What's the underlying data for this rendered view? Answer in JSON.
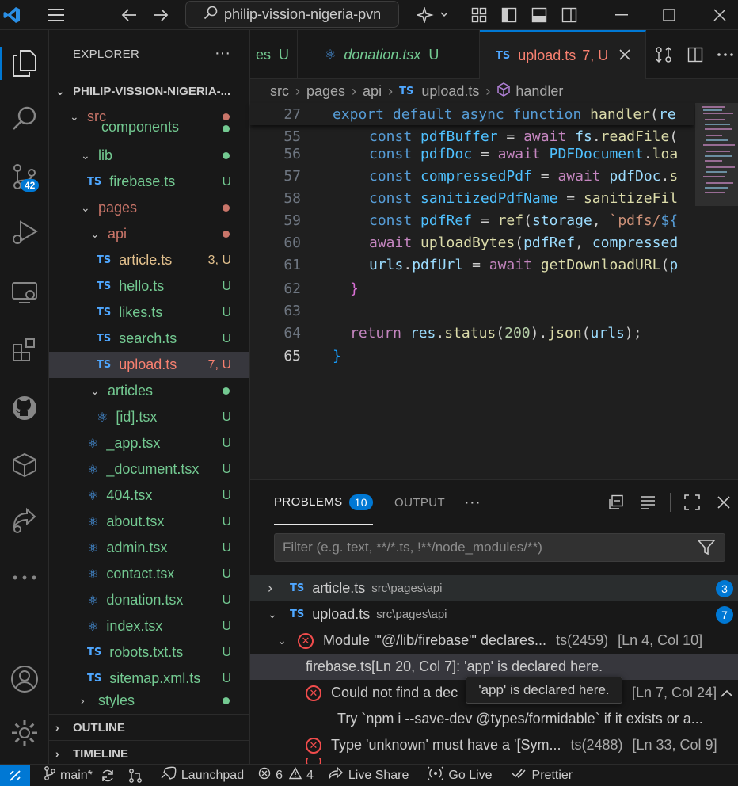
{
  "colors": {
    "accent": "#0078d4",
    "untracked": "#73c991",
    "modified_warn": "#e2c08d",
    "error": "#f14c4c"
  },
  "titlebar": {
    "app_icon": "vscode-logo-icon",
    "search_text": "philip-vission-nigeria-pvn"
  },
  "activity": {
    "source_control_badge": "42"
  },
  "explorer": {
    "title": "EXPLORER",
    "more": "···",
    "workspace": "PHILIP-VISSION-NIGERIA-...",
    "items": [
      {
        "label": "src",
        "status": "",
        "dot": "#c97569"
      },
      {
        "label": "components",
        "status": "",
        "dot": "#73c991"
      },
      {
        "label": "lib",
        "status": "",
        "dot": "#73c991"
      },
      {
        "label": "firebase.ts",
        "status": "U"
      },
      {
        "label": "pages",
        "status": "",
        "dot": "#c97569"
      },
      {
        "label": "api",
        "status": "",
        "dot": "#c97569"
      },
      {
        "label": "article.ts",
        "status": "3, U"
      },
      {
        "label": "hello.ts",
        "status": "U"
      },
      {
        "label": "likes.ts",
        "status": "U"
      },
      {
        "label": "search.ts",
        "status": "U"
      },
      {
        "label": "upload.ts",
        "status": "7, U"
      },
      {
        "label": "articles",
        "status": "",
        "dot": "#73c991"
      },
      {
        "label": "[id].tsx",
        "status": "U"
      },
      {
        "label": "_app.tsx",
        "status": "U"
      },
      {
        "label": "_document.tsx",
        "status": "U"
      },
      {
        "label": "404.tsx",
        "status": "U"
      },
      {
        "label": "about.tsx",
        "status": "U"
      },
      {
        "label": "admin.tsx",
        "status": "U"
      },
      {
        "label": "contact.tsx",
        "status": "U"
      },
      {
        "label": "donation.tsx",
        "status": "U"
      },
      {
        "label": "index.tsx",
        "status": "U"
      },
      {
        "label": "robots.txt.ts",
        "status": "U"
      },
      {
        "label": "sitemap.xml.ts",
        "status": "U"
      },
      {
        "label": "styles",
        "status": "",
        "dot": "#73c991"
      }
    ],
    "outline": "OUTLINE",
    "timeline": "TIMELINE"
  },
  "tabs": [
    {
      "label": "es",
      "status": "U"
    },
    {
      "label": "donation.tsx",
      "status": "U"
    },
    {
      "label": "upload.ts",
      "status": "7, U"
    }
  ],
  "breadcrumbs": [
    "src",
    "pages",
    "api",
    "upload.ts",
    "handler"
  ],
  "editor": {
    "sticky_line": "27",
    "line_numbers": [
      "55",
      "56",
      "57",
      "58",
      "59",
      "60",
      "61",
      "62",
      "63",
      "64",
      "65"
    ]
  },
  "panel": {
    "tabs": [
      "PROBLEMS",
      "OUTPUT"
    ],
    "problem_count": "10",
    "more": "···",
    "filter_placeholder": "Filter (e.g. text, **/*.ts, !**/node_modules/**)",
    "groups": [
      {
        "file": "article.ts",
        "path": "src\\pages\\api",
        "count": "3"
      },
      {
        "file": "upload.ts",
        "path": "src\\pages\\api",
        "count": "7"
      }
    ],
    "problems": [
      {
        "message": "Module '\"@/lib/firebase\"' declares...",
        "code": "ts(2459)",
        "location": "[Ln 4, Col 10]"
      },
      {
        "related": "firebase.ts[Ln 20, Col 7]: 'app' is declared here."
      },
      {
        "message": "Could not find a dec",
        "location": "[Ln 7, Col 24]"
      },
      {
        "hint": "Try `npm i --save-dev @types/formidable` if it exists or a..."
      },
      {
        "message": "Type 'unknown' must have a '[Sym...",
        "code": "ts(2488)",
        "location": "[Ln 33, Col 9]"
      }
    ],
    "tooltip": "'app' is declared here."
  },
  "statusbar": {
    "branch": "main*",
    "launchpad": "Launchpad",
    "errors": "6",
    "warnings": "4",
    "live_share": "Live Share",
    "go_live": "Go Live",
    "prettier": "Prettier"
  }
}
